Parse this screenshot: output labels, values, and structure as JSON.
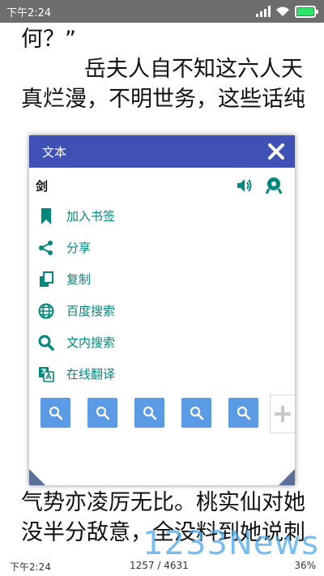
{
  "status_bar": {
    "time": "下午2:24"
  },
  "reader": {
    "lines_top": [
      "何？”",
      "岳夫人自不知这六人天",
      "真烂漫，不明世务，这些话纯"
    ],
    "lines_bottom": [
      "气势亦凌厉无比。桃实仙对她",
      "没半分敌意，全没料到她说刺"
    ]
  },
  "popup": {
    "title": "文本",
    "word": "剑",
    "menu": [
      {
        "icon": "bookmark-icon",
        "label": "加入书签"
      },
      {
        "icon": "share-icon",
        "label": "分享"
      },
      {
        "icon": "copy-icon",
        "label": "复制"
      },
      {
        "icon": "globe-icon",
        "label": "百度搜索"
      },
      {
        "icon": "search-icon",
        "label": "文内搜索"
      },
      {
        "icon": "translate-icon",
        "label": "在线翻译"
      }
    ],
    "search_button_count": 5
  },
  "bottom_bar": {
    "time": "下午2:24",
    "page": "1257 / 4631",
    "percent": "36%"
  },
  "watermark": "1233News",
  "colors": {
    "header": "#3f51b5",
    "accent": "#00897b",
    "search_button": "#5b9be6"
  }
}
